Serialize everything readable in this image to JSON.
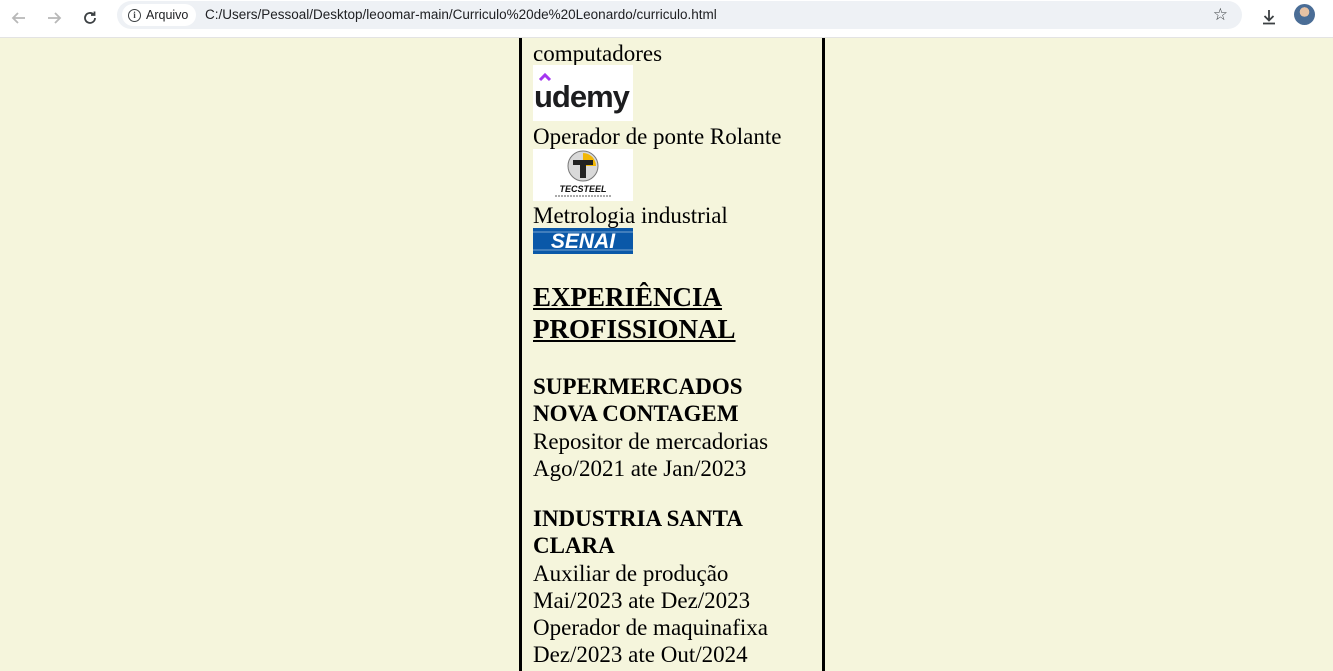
{
  "browser": {
    "chip_label": "Arquivo",
    "url": "C:/Users/Pessoal/Desktop/leoomar-main/Curriculo%20de%20Leonardo/curriculo.html"
  },
  "courses": [
    {
      "name": "computadores",
      "logo": "udemy-logo"
    },
    {
      "name": "Operador de ponte Rolante",
      "logo": "tecsteel-logo"
    },
    {
      "name": "Metrologia industrial",
      "logo": "senai-logo"
    }
  ],
  "logos": {
    "udemy": "udemy",
    "tecsteel": "TECSTEEL",
    "senai": "SENAI"
  },
  "experience": {
    "heading_line1": "EXPERIÊNCIA",
    "heading_line2": "PROFISSIONAL",
    "jobs": [
      {
        "company_line1": "SUPERMERCADOS",
        "company_line2": "NOVA CONTAGEM",
        "role": "Repositor de mercadorias",
        "period": "Ago/2021 ate Jan/2023"
      },
      {
        "company_line1": "INDUSTRIA SANTA",
        "company_line2": "CLARA",
        "role": "Auxiliar de produção",
        "period": "Mai/2023 ate Dez/2023",
        "role2": "Operador de maquinafixa",
        "period2": "Dez/2023 ate Out/2024"
      }
    ]
  },
  "colors": {
    "page_background": "#f5f5dc",
    "udemy_purple": "#a435f0",
    "senai_blue": "#0a58a8"
  }
}
